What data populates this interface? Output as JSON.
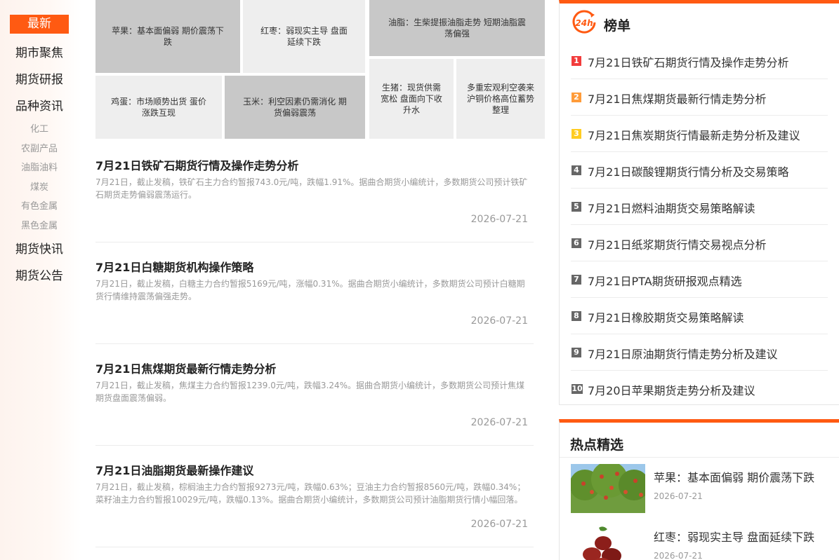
{
  "nav": {
    "active": "最新",
    "main": [
      "期市聚焦",
      "期货研报",
      "品种资讯"
    ],
    "sub": [
      "化工",
      "农副产品",
      "油脂油料",
      "煤炭",
      "有色金属",
      "黑色金属"
    ],
    "bottom": [
      "期货快讯",
      "期货公告"
    ]
  },
  "tiles": [
    "苹果：基本面偏弱 期价震荡下跌",
    "红枣：弱现实主导 盘面延续下跌",
    "油脂：生柴提振油脂走势 短期油脂震荡偏强",
    "鸡蛋：市场顺势出货 蛋价涨跌互现",
    "玉米：利空因素仍需消化 期货偏弱震荡",
    "生猪：现货供需宽松 盘面向下收升水",
    "多重宏观利空袭来 沪铜价格高位蓄势整理"
  ],
  "articles": [
    {
      "title": "7月21日铁矿石期货行情及操作走势分析",
      "summary": "7月21日，截止发稿，铁矿石主力合约暂报743.0元/吨，跌幅1.91%。据曲合期货小编统计，多数期货公司预计铁矿石期货走势偏弱震荡运行。",
      "date": "2026-07-21"
    },
    {
      "title": "7月21日白糖期货机构操作策略",
      "summary": "7月21日，截止发稿，白糖主力合约暂报5169元/吨，涨幅0.31%。据曲合期货小编统计，多数期货公司预计白糖期货行情维持震荡偏强走势。",
      "date": "2026-07-21"
    },
    {
      "title": "7月21日焦煤期货最新行情走势分析",
      "summary": "7月21日，截止发稿，焦煤主力合约暂报1239.0元/吨，跌幅3.24%。据曲合期货小编统计，多数期货公司预计焦煤期货盘面震荡偏弱。",
      "date": "2026-07-21"
    },
    {
      "title": "7月21日油脂期货最新操作建议",
      "summary": "7月21日，截止发稿，棕榈油主力合约暂报9273元/吨，跌幅0.63%；豆油主力合约暂报8560元/吨，跌幅0.34%；菜籽油主力合约暂报10029元/吨，跌幅0.13%。据曲合期货小编统计，多数期货公司预计油脂期货行情小幅回落。",
      "date": "2026-07-21"
    }
  ],
  "ranking": {
    "badge": "24h",
    "title": "榜单",
    "items": [
      {
        "num": "1",
        "text": "7月21日铁矿石期货行情及操作走势分析",
        "color": "#f23c3c"
      },
      {
        "num": "2",
        "text": "7月21日焦煤期货最新行情走势分析",
        "color": "#ff9c3a"
      },
      {
        "num": "3",
        "text": "7月21日焦炭期货行情最新走势分析及建议",
        "color": "#ffcc22"
      },
      {
        "num": "4",
        "text": "7月21日碳酸锂期货行情分析及交易策略",
        "color": "#666666"
      },
      {
        "num": "5",
        "text": "7月21日燃料油期货交易策略解读",
        "color": "#666666"
      },
      {
        "num": "6",
        "text": "7月21日纸浆期货行情交易视点分析",
        "color": "#666666"
      },
      {
        "num": "7",
        "text": "7月21日PTA期货研报观点精选",
        "color": "#666666"
      },
      {
        "num": "8",
        "text": "7月21日橡胶期货交易策略解读",
        "color": "#666666"
      },
      {
        "num": "9",
        "text": "7月21日原油期货行情走势分析及建议",
        "color": "#666666"
      },
      {
        "num": "10",
        "text": "7月20日苹果期货走势分析及建议",
        "color": "#666666"
      }
    ]
  },
  "hot": {
    "title": "热点精选",
    "items": [
      {
        "text": "苹果：基本面偏弱 期价震荡下跌",
        "date": "2026-07-21"
      },
      {
        "text": "红枣：弱现实主导 盘面延续下跌",
        "date": "2026-07-21"
      }
    ]
  },
  "colors": {
    "accent": "#ff5a12"
  }
}
